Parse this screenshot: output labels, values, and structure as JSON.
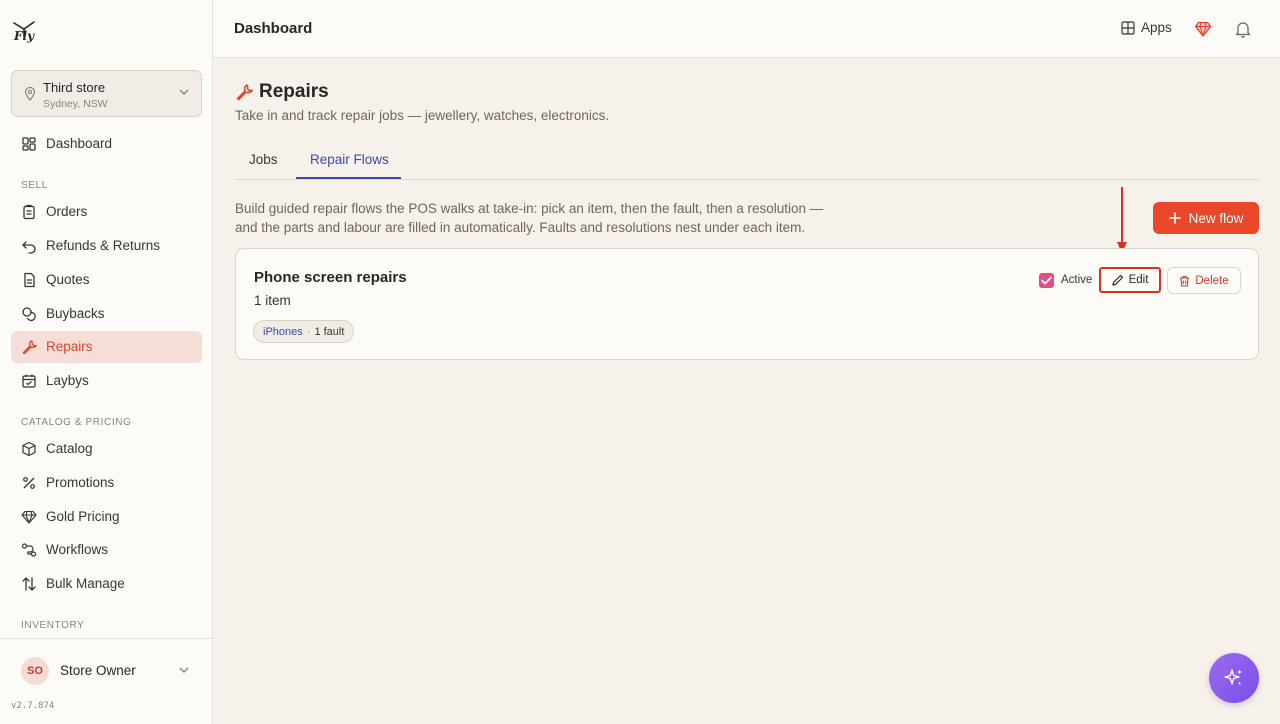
{
  "brand": {
    "logo_text": "Fly"
  },
  "store": {
    "name": "Third store",
    "location": "Sydney, NSW"
  },
  "sidebar": {
    "dashboard": "Dashboard",
    "sections": [
      "SELL",
      "CATALOG & PRICING",
      "INVENTORY"
    ],
    "sell_items": [
      "Orders",
      "Refunds & Returns",
      "Quotes",
      "Buybacks",
      "Repairs",
      "Laybys"
    ],
    "catalog_items": [
      "Catalog",
      "Promotions",
      "Gold Pricing",
      "Workflows",
      "Bulk Manage"
    ],
    "active_item": "Repairs"
  },
  "user": {
    "initials": "SO",
    "name": "Store Owner"
  },
  "version": "v2.7.874",
  "topbar": {
    "title": "Dashboard",
    "apps_label": "Apps"
  },
  "page": {
    "title": "Repairs",
    "subtitle": "Take in and track repair jobs — jewellery, watches, electronics.",
    "tabs": [
      "Jobs",
      "Repair Flows"
    ],
    "active_tab": "Repair Flows",
    "description_line1": "Build guided repair flows the POS walks at take-in: pick an item, then the fault, then a resolution —",
    "description_line2": "and the parts and labour are filled in automatically. Faults and resolutions nest under each item.",
    "new_flow_label": "New flow"
  },
  "flow_card": {
    "name": "Phone screen repairs",
    "count": "1 item",
    "chip_item": "iPhones",
    "chip_sep": "·",
    "chip_faults": "1 fault",
    "active_label": "Active",
    "active_checked": true,
    "edit_label": "Edit",
    "delete_label": "Delete"
  },
  "colors": {
    "accent": "#e9472a",
    "active_nav": "#d9472b",
    "tab_blue": "#3b4aa8",
    "checkbox": "#e24f87",
    "fab": "#8a5cec"
  }
}
